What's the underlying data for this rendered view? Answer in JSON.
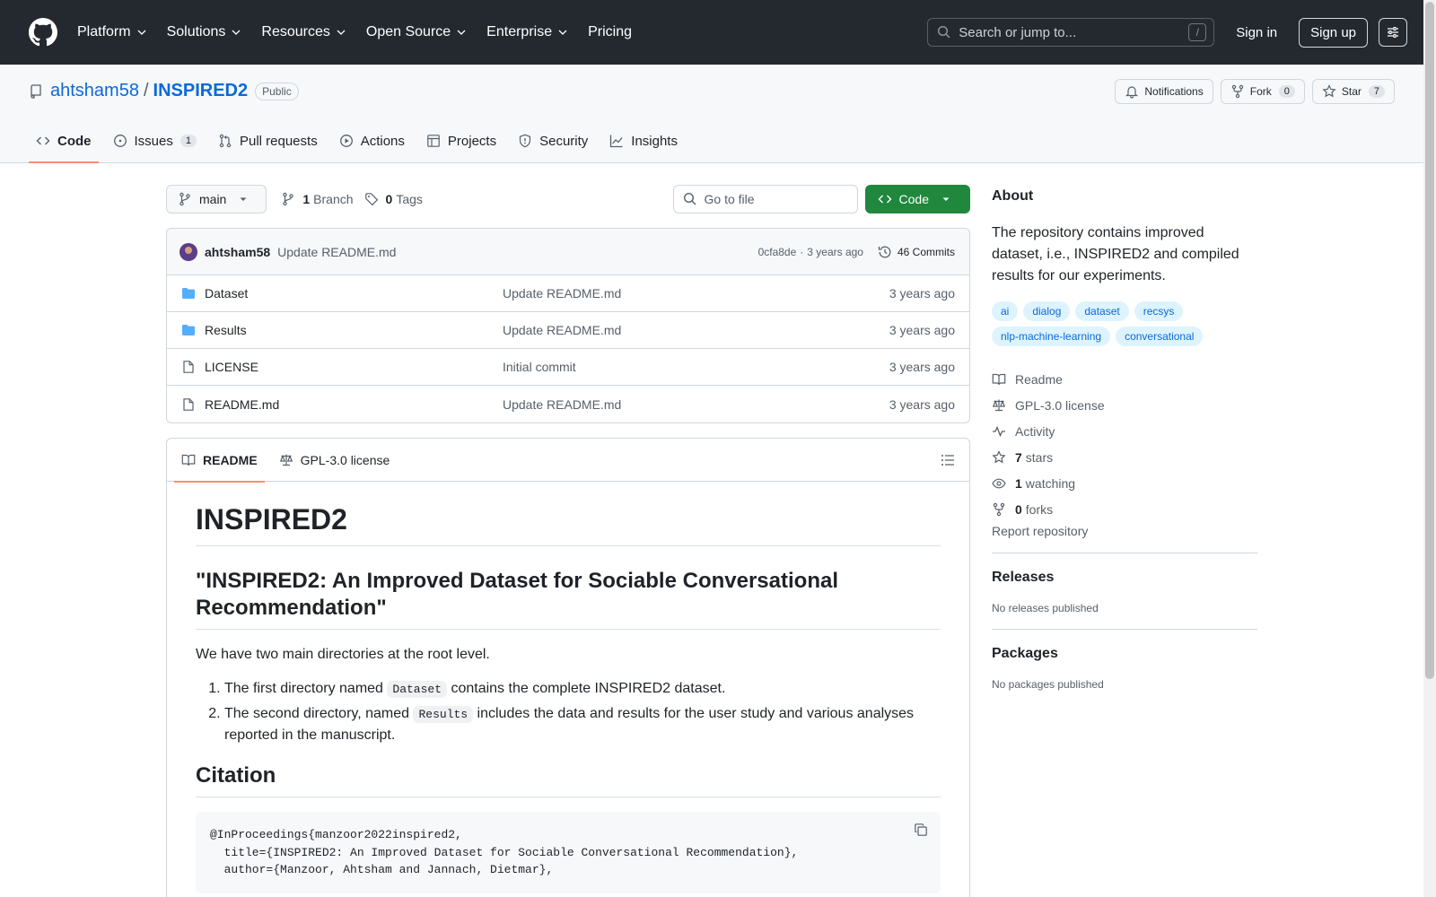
{
  "header": {
    "nav": [
      "Platform",
      "Solutions",
      "Resources",
      "Open Source",
      "Enterprise",
      "Pricing"
    ],
    "search_placeholder": "Search or jump to...",
    "search_shortcut": "/",
    "signin": "Sign in",
    "signup": "Sign up"
  },
  "repo": {
    "owner": "ahtsham58",
    "separator": "/",
    "name": "INSPIRED2",
    "visibility": "Public",
    "notifications_label": "Notifications",
    "fork_label": "Fork",
    "fork_count": "0",
    "star_label": "Star",
    "star_count": "7"
  },
  "tabs": {
    "code": "Code",
    "issues": "Issues",
    "issues_count": "1",
    "pulls": "Pull requests",
    "actions": "Actions",
    "projects": "Projects",
    "security": "Security",
    "insights": "Insights"
  },
  "filebar": {
    "branch": "main",
    "branch_count": "1",
    "branch_label": "Branch",
    "tag_count": "0",
    "tag_label": "Tags",
    "goto_placeholder": "Go to file",
    "code_button": "Code"
  },
  "commit": {
    "author": "ahtsham58",
    "message": "Update README.md",
    "hash": "0cfa8de",
    "dot": "·",
    "age": "3 years ago",
    "commits": "46 Commits"
  },
  "files": [
    {
      "name": "Dataset",
      "message": "Update README.md",
      "age": "3 years ago",
      "type": "folder"
    },
    {
      "name": "Results",
      "message": "Update README.md",
      "age": "3 years ago",
      "type": "folder"
    },
    {
      "name": "LICENSE",
      "message": "Initial commit",
      "age": "3 years ago",
      "type": "file"
    },
    {
      "name": "README.md",
      "message": "Update README.md",
      "age": "3 years ago",
      "type": "file"
    }
  ],
  "readme": {
    "tab_readme": "README",
    "tab_license": "GPL-3.0 license",
    "h1": "INSPIRED2",
    "h2": "\"INSPIRED2: An Improved Dataset for Sociable Conversational Recommendation\"",
    "p1": "We have two main directories at the root level.",
    "li1_a": "The first directory named ",
    "li1_code": "Dataset",
    "li1_b": " contains the complete INSPIRED2 dataset.",
    "li2_a": "The second directory, named ",
    "li2_code": "Results",
    "li2_b": " includes the data and results for the user study and various analyses reported in the manuscript.",
    "h2_citation": "Citation",
    "code": "@InProceedings{manzoor2022inspired2,\n  title={INSPIRED2: An Improved Dataset for Sociable Conversational Recommendation},\n  author={Manzoor, Ahtsham and Jannach, Dietmar},"
  },
  "about": {
    "heading": "About",
    "description": "The repository contains improved dataset, i.e., INSPIRED2 and compiled results for our experiments.",
    "topics": [
      "ai",
      "dialog",
      "dataset",
      "recsys",
      "nlp-machine-learning",
      "conversational"
    ],
    "readme": "Readme",
    "license": "GPL-3.0 license",
    "activity": "Activity",
    "stars_count": "7",
    "stars_label": "stars",
    "watching_count": "1",
    "watching_label": "watching",
    "forks_count": "0",
    "forks_label": "forks",
    "report": "Report repository"
  },
  "releases": {
    "heading": "Releases",
    "empty": "No releases published"
  },
  "packages": {
    "heading": "Packages",
    "empty": "No packages published"
  }
}
